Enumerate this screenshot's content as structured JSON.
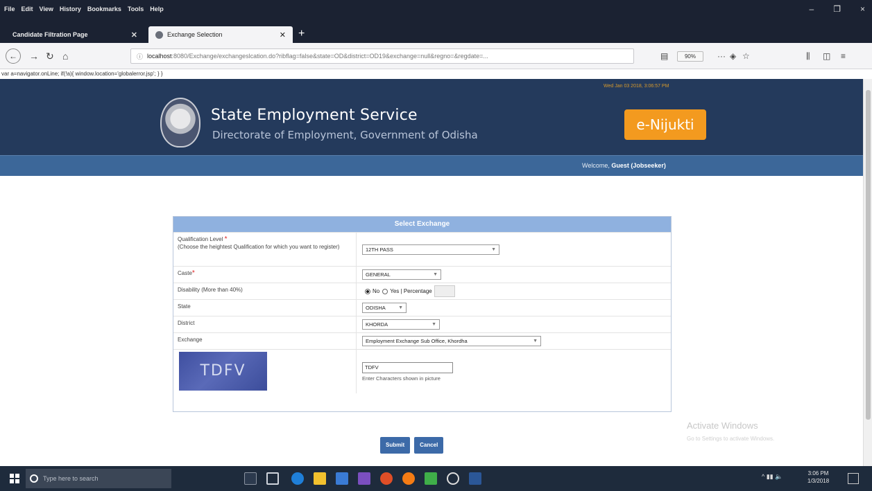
{
  "browser": {
    "menu": [
      "File",
      "Edit",
      "View",
      "History",
      "Bookmarks",
      "Tools",
      "Help"
    ],
    "window_controls": [
      "–",
      "❐",
      "×"
    ],
    "tabs": [
      {
        "title": "Candidate Filtration Page",
        "active": false
      },
      {
        "title": "Exchange Selection",
        "active": true
      }
    ],
    "new_tab": "+",
    "url_host": "localhost",
    "url_rest": ":8080/Exchange/exchangeslcation.do?ribflag=false&state=OD&district=OD19&exchange=null&regno=&regdate=...",
    "zoom": "90%",
    "script_line": "var a=navigator.onLine; if(!a){ window.location='globalerror.jsp'; } }"
  },
  "header": {
    "datetime": "Wed Jan 03 2018, 3:06:57 PM",
    "title": "State Employment Service",
    "subtitle": "Directorate of Employment, Government of Odisha",
    "brand": "e-Nijukti",
    "welcome_prefix": "Welcome,",
    "welcome_user": "Guest (Jobseeker)"
  },
  "form": {
    "heading": "Select Exchange",
    "qualification_label": "Qualification Level",
    "qualification_hint": "(Choose the heightest Qualification for which you want to register)",
    "qualification_value": "12TH PASS",
    "caste_label": "Caste",
    "caste_value": "GENERAL",
    "disability_label": "Disability (More than 40%)",
    "disability_no": "No",
    "disability_yes": "Yes",
    "disability_percentage": "| Percentage",
    "state_label": "State",
    "state_value": "ODISHA",
    "district_label": "District",
    "district_value": "KHORDA",
    "exchange_label": "Exchange",
    "exchange_value": "Employment Exchange Sub Office, Khordha",
    "captcha_text": "TDFV",
    "captcha_input": "TDFV",
    "captcha_hint": "Enter Characters shown in picture",
    "submit": "Submit",
    "cancel": "Cancel"
  },
  "watermark": {
    "line1": "Activate Windows",
    "line2": "Go to Settings to activate Windows."
  },
  "taskbar": {
    "search_placeholder": "Type here to search",
    "time": "3:06 PM",
    "date": "1/3/2018"
  }
}
